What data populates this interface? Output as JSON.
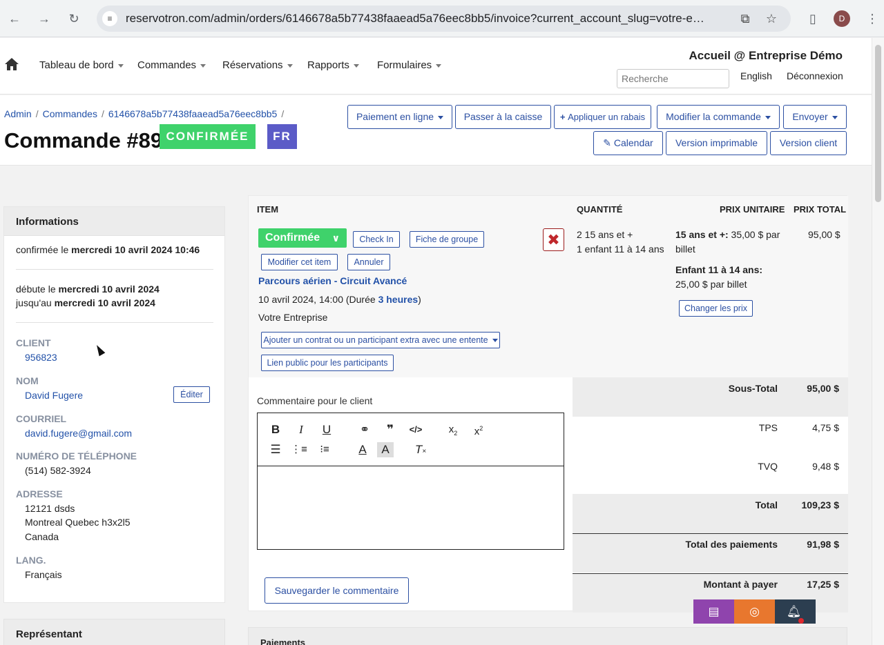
{
  "browser": {
    "url": "reservotron.com/admin/orders/6146678a5b77438faaead5a76eec8bb5/invoice?current_account_slug=votre-e…",
    "profile_initial": "D"
  },
  "header": {
    "nav": [
      {
        "label": "Tableau de bord"
      },
      {
        "label": "Commandes"
      },
      {
        "label": "Réservations"
      },
      {
        "label": "Rapports"
      },
      {
        "label": "Formulaires"
      }
    ],
    "brand": "Accueil @ Entreprise Démo",
    "search_placeholder": "Recherche",
    "lang_link": "English",
    "logout": "Déconnexion"
  },
  "titlebar": {
    "breadcrumb": [
      "Admin",
      "Commandes",
      "6146678a5b77438faaead5a76eec8bb5"
    ],
    "title": "Commande #89",
    "status_badge": "CONFIRMÉE",
    "lang_badge": "FR",
    "buttons": {
      "online_payment": "Paiement en ligne",
      "checkout": "Passer à la caisse",
      "discount": "Appliquer un rabais",
      "modify": "Modifier la commande",
      "send": "Envoyer",
      "calendar": "Calendar",
      "printable": "Version imprimable",
      "client_version": "Version client"
    }
  },
  "info": {
    "heading": "Informations",
    "confirmed_prefix": "confirmée le ",
    "confirmed_date": "mercredi 10 avril 2024 10:46",
    "starts_prefix": "débute le ",
    "starts_date": "mercredi 10 avril 2024",
    "until_prefix": "jusqu'au ",
    "until_date": "mercredi 10 avril 2024",
    "client_label": "CLIENT",
    "client_id": "956823",
    "name_label": "NOM",
    "name": "David Fugere",
    "edit_button": "Éditer",
    "email_label": "COURRIEL",
    "email": "david.fugere@gmail.com",
    "phone_label": "NUMÉRO DE TÉLÉPHONE",
    "phone": "(514) 582-3924",
    "address_label": "ADRESSE",
    "address_line1": "12121 dsds",
    "address_line2": "Montreal Quebec h3x2l5",
    "address_line3": "Canada",
    "lang_label": "LANG.",
    "lang": "Français",
    "rep_heading": "Représentant"
  },
  "items": {
    "headers": {
      "item": "ITEM",
      "qty": "QUANTITÉ",
      "unit_price": "PRIX UNITAIRE",
      "total_price": "PRIX TOTAL"
    },
    "status": "Confirmée",
    "check_in": "Check In",
    "group_sheet": "Fiche de groupe",
    "modify_item": "Modifier cet item",
    "cancel": "Annuler",
    "title": "Parcours aérien - Circuit Avancé",
    "date_prefix": "10 avril 2024, 14:00 (Durée ",
    "duration": "3 heures",
    "date_suffix": ")",
    "company": "Votre Entreprise",
    "add_contract": "Ajouter un contrat ou un participant extra avec une entente",
    "public_link": "Lien public pour les participants",
    "qty_line1": "2 15 ans et +",
    "qty_line2": "1 enfant 11 à 14 ans",
    "price1_label": "15 ans et +:",
    "price1_value": " 35,00 $ par",
    "price1_unit": "billet",
    "price2_label": "Enfant 11 à 14 ans:",
    "price2_value": "25,00 $ par billet",
    "change_prices": "Changer les prix",
    "total": "95,00 $"
  },
  "totals": [
    {
      "label": "Sous-Total",
      "value": "95,00 $"
    },
    {
      "label": "TPS",
      "value": "4,75 $"
    },
    {
      "label": "TVQ",
      "value": "9,48 $"
    },
    {
      "label": "Total",
      "value": "109,23 $"
    },
    {
      "label": "Total des paiements",
      "value": "91,98 $"
    },
    {
      "label": "Montant à payer",
      "value": "17,25 $"
    }
  ],
  "comment": {
    "label": "Commentaire pour le client",
    "save_button": "Sauvegarder le commentaire"
  },
  "payments": {
    "heading": "Paiements"
  },
  "colors": {
    "accent": "#2b4fa2",
    "confirmed": "#3fd26b",
    "lang_badge": "#5b5bc7"
  }
}
